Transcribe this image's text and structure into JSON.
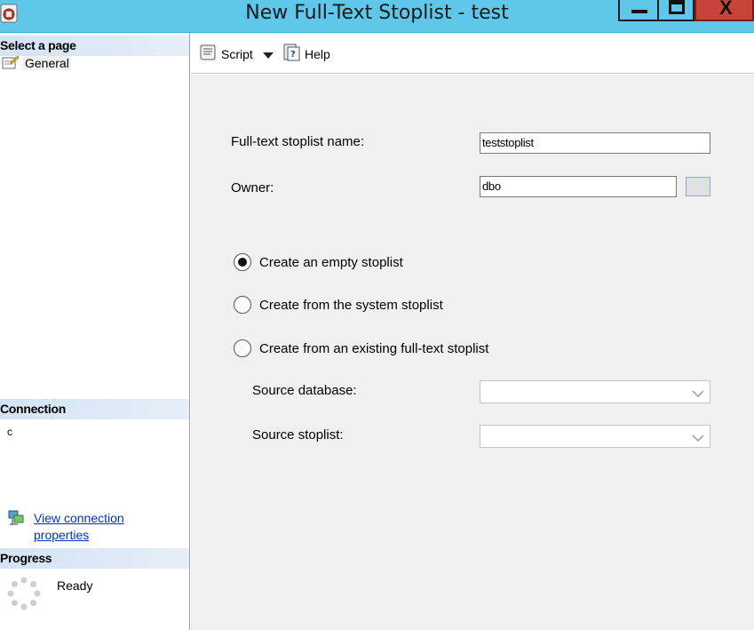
{
  "window": {
    "title": "New Full-Text Stoplist - test",
    "minimize_glyph": "—",
    "close_glyph": "X"
  },
  "left_pane": {
    "select_page_header": "Select a page",
    "pages": [
      {
        "label": "General",
        "icon": "properties-page-icon"
      }
    ],
    "connection_header": "Connection",
    "connection_text": "c",
    "view_connection_link": "View connection properties",
    "progress_header": "Progress",
    "progress_status": "Ready"
  },
  "toolbar": {
    "script_label": "Script",
    "help_label": "Help"
  },
  "form": {
    "name_label": "Full-text stoplist name:",
    "name_value": "teststoplist",
    "owner_label": "Owner:",
    "owner_value": "dbo",
    "options": [
      {
        "label": "Create an empty stoplist",
        "checked": true
      },
      {
        "label": "Create from the system stoplist",
        "checked": false
      },
      {
        "label": "Create from an existing full-text stoplist",
        "checked": false
      }
    ],
    "source_database_label": "Source database:",
    "source_database_value": "",
    "source_stoplist_label": "Source stoplist:",
    "source_stoplist_value": ""
  },
  "colors": {
    "titlebar": "#5fc8ea",
    "close_button": "#c8443a",
    "section_header": "#d3e3f3",
    "link": "#0033cc",
    "content_bg": "#f0f0f0"
  }
}
